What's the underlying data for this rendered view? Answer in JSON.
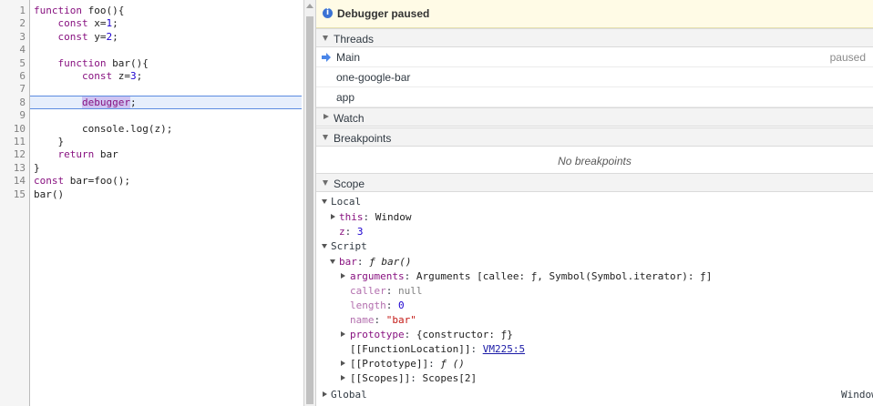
{
  "editor": {
    "lines": [
      {
        "n": "1",
        "text": "function foo(){"
      },
      {
        "n": "2",
        "text": "    const x=1;"
      },
      {
        "n": "3",
        "text": "    const y=2;"
      },
      {
        "n": "4",
        "text": ""
      },
      {
        "n": "5",
        "text": "    function bar(){"
      },
      {
        "n": "6",
        "text": "        const z=3;"
      },
      {
        "n": "7",
        "text": ""
      },
      {
        "n": "8",
        "text": "        debugger;"
      },
      {
        "n": "9",
        "text": ""
      },
      {
        "n": "10",
        "text": "        console.log(z);"
      },
      {
        "n": "11",
        "text": "    }"
      },
      {
        "n": "12",
        "text": "    return bar"
      },
      {
        "n": "13",
        "text": "}"
      },
      {
        "n": "14",
        "text": "const bar=foo();"
      },
      {
        "n": "15",
        "text": "bar()"
      }
    ],
    "current_line": "8"
  },
  "sidebar": {
    "banner": {
      "label": "Debugger paused",
      "icon": "info-icon"
    },
    "threads": {
      "title": "Threads",
      "items": [
        {
          "name": "Main",
          "status": "paused",
          "current": true
        },
        {
          "name": "one-google-bar",
          "status": ""
        },
        {
          "name": "app",
          "status": ""
        }
      ]
    },
    "watch": {
      "title": "Watch"
    },
    "breakpoints": {
      "title": "Breakpoints",
      "empty": "No breakpoints"
    },
    "scope": {
      "title": "Scope",
      "local_label": "Local",
      "local_this_name": "this",
      "local_this_value": "Window",
      "local_z_name": "z",
      "local_z_value": "3",
      "script_label": "Script",
      "bar_name": "bar",
      "bar_value": "ƒ bar()",
      "arguments_name": "arguments",
      "arguments_value": "Arguments [callee: ƒ, Symbol(Symbol.iterator): ƒ]",
      "caller_name": "caller",
      "caller_value": "null",
      "length_name": "length",
      "length_value": "0",
      "name_name": "name",
      "name_value": "\"bar\"",
      "prototype_name": "prototype",
      "prototype_value": "{constructor: ƒ}",
      "fnloc_name": "[[FunctionLocation]]",
      "fnloc_value": "VM225:5",
      "proto_name": "[[Prototype]]",
      "proto_value": "ƒ ()",
      "scopes_name": "[[Scopes]]",
      "scopes_value": "Scopes[2]",
      "global_label": "Global",
      "global_value": "Window"
    }
  },
  "colors": {
    "keyword": "#881280",
    "number": "#1c00cf",
    "string": "#c41a16",
    "banner_bg": "#fffbe6",
    "exec_line_bg": "#e6eefc"
  }
}
